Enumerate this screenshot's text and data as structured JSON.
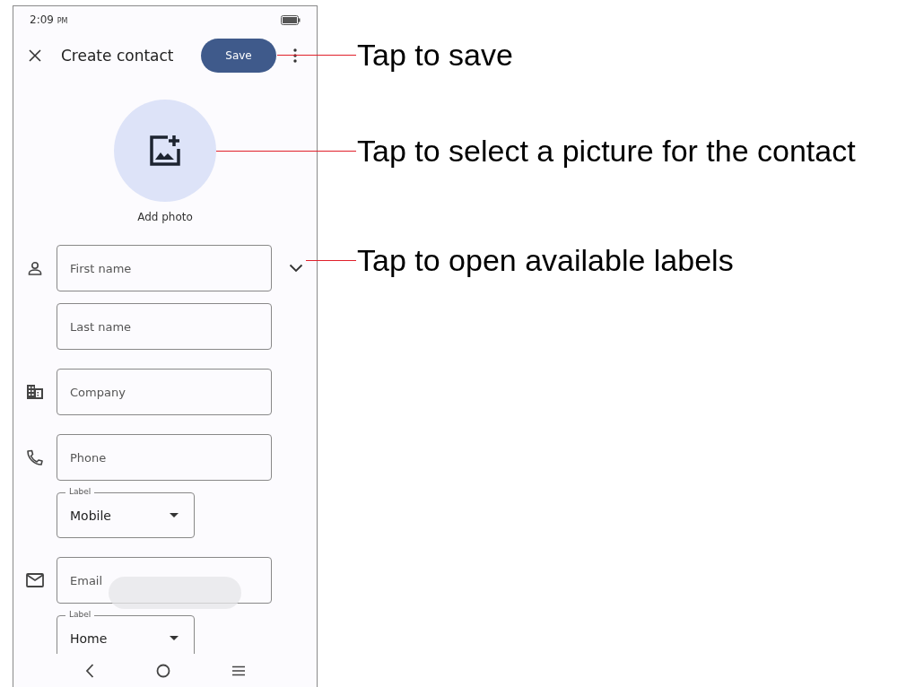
{
  "status_bar": {
    "time": "2:09",
    "time_suffix": "PM"
  },
  "header": {
    "title": "Create contact",
    "save_button": "Save"
  },
  "photo": {
    "label": "Add photo"
  },
  "fields": [
    {
      "kind": "text",
      "placeholder": "First name",
      "expandable": true
    },
    {
      "kind": "text",
      "placeholder": "Last name",
      "expandable": false
    },
    {
      "kind": "text",
      "placeholder": "Company",
      "expandable": false
    },
    {
      "kind": "text",
      "placeholder": "Phone",
      "expandable": false
    },
    {
      "kind": "dropdown",
      "label": "Label",
      "value": "Mobile"
    },
    {
      "kind": "text",
      "placeholder": "Email",
      "expandable": false
    },
    {
      "kind": "dropdown",
      "label": "Label",
      "value": "Home"
    }
  ],
  "callouts": [
    {
      "text": "Tap to save"
    },
    {
      "text": "Tap to select a picture for the contact"
    },
    {
      "text": "Tap to open available labels"
    }
  ]
}
